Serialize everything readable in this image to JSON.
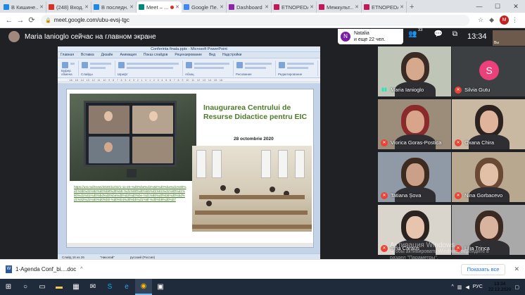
{
  "browser": {
    "tabs": [
      {
        "label": "В Кишине...",
        "color": "#1e88e5",
        "active": false
      },
      {
        "label": "(248) Вход...",
        "color": "#d93025",
        "active": false
      },
      {
        "label": "В последн...",
        "color": "#1e88e5",
        "active": false
      },
      {
        "label": "Meet – ...",
        "color": "#00897b",
        "active": true
      },
      {
        "label": "Google Пе...",
        "color": "#4285f4",
        "active": false
      },
      {
        "label": "Dashboard",
        "color": "#8e24aa",
        "active": false
      },
      {
        "label": "ETNOPEDA...",
        "color": "#c2185b",
        "active": false
      },
      {
        "label": "Межкульт...",
        "color": "#c2185b",
        "active": false
      },
      {
        "label": "ETNOPEDA...",
        "color": "#c2185b",
        "active": false
      }
    ],
    "url": "meet.google.com/ubu-evsj-tgc",
    "profile_initial": "M"
  },
  "meet": {
    "presenter_status": "Maria Ianioglo сейчас на главном экране",
    "participant_pill": {
      "initial": "N",
      "line1": "Natalia",
      "line2": "и еще 22 чел."
    },
    "participant_count": "33",
    "clock": "13:34",
    "self_label": "Вы",
    "tiles": [
      {
        "name": "Maria Ianioglo",
        "muted": false,
        "bg": "#bfc6b8",
        "face": "#d7a98c",
        "hair": "#3a2b25"
      },
      {
        "name": "Silvia Gutu",
        "muted": true,
        "bg": "#3c4043",
        "avatar": "S"
      },
      {
        "name": "Viorica Goras-Postica",
        "muted": true,
        "bg": "#9c8c7a",
        "face": "#d8a58c",
        "hair": "#8b2a2a"
      },
      {
        "name": "Oxana Chira",
        "muted": true,
        "bg": "#c9b9a2",
        "face": "#e0b49a",
        "hair": "#2c2220"
      },
      {
        "name": "Tatiana Șova",
        "muted": true,
        "bg": "#8f9aa6",
        "face": "#caa188",
        "hair": "#3d2b20"
      },
      {
        "name": "Nina Gorbacevo",
        "muted": true,
        "bg": "#b7a88f",
        "face": "#e2c0a8",
        "hair": "#6b4a35"
      },
      {
        "name": "Irina Caraus",
        "muted": true,
        "bg": "#d9d4cc",
        "face": "#e6c4ad",
        "hair": "#2b2320"
      },
      {
        "name": "Lilia Trinca",
        "muted": true,
        "bg": "#a9a9a9",
        "face": "#d8b39d",
        "hair": "#3b2a22"
      }
    ],
    "watermark": {
      "line1": "Активация Windows",
      "line2": "Чтобы активировать Windows, перейдите в",
      "line3": "раздел \"Параметры\"."
    }
  },
  "powerpoint": {
    "window_title": "Conferinta finala.pptx - Microsoft PowerPoint",
    "menu": [
      "Главная",
      "Вставка",
      "Дизайн",
      "Анимация",
      "Показ слайдов",
      "Рецензирование",
      "Вид",
      "Надстройки"
    ],
    "ribbon_groups": [
      "Буфер обмена",
      "Слайды",
      "Шрифт",
      "Абзац",
      "Рисование",
      "Редактирование"
    ],
    "ruler": "· 16 · 15 · 14 · 13 · 12 · 11 · 10 · 9 · 8 · 7 · 6 · 5 · 4 · 3 · 2 · 1 · 0 · 1 · 2 · 3 · 4 · 5 · 6 · 7 · 8 · 9 · 10 · 11 · 12 · 13 · 14 · 15 · 16 ·",
    "status": [
      "Слайд 16 из 26",
      "\"Николай\"",
      "русский (Россия)"
    ],
    "slide": {
      "title": "Inaugurarea Centrului de Resurse Didactice pentru EIC",
      "date": "28 octombrie 2020",
      "link": "https://ust.md/news/2020/11/02/1-11-20-%d0%be%d1%82%d0%ba%d1%80%d1%8b%d1%82%d0%b8%d0%b5-%d1%80%d0%b5%d1%81%d1%83%d1%80%d1%81%d0%bd%d0%be%d0%b3%d0%be-%d1%86%d0%b5%d0%bd%d1%82%d1%80%d0%b0-%d0%b4%d0%bb%d1%8f-%d0%b8%d0%b7"
    }
  },
  "downloads": {
    "file": "1-Agenda Conf_bi....doc",
    "show_all": "Показать все"
  },
  "taskbar": {
    "lang": "РУС",
    "time": "13:34",
    "date": "22.12.2020"
  }
}
